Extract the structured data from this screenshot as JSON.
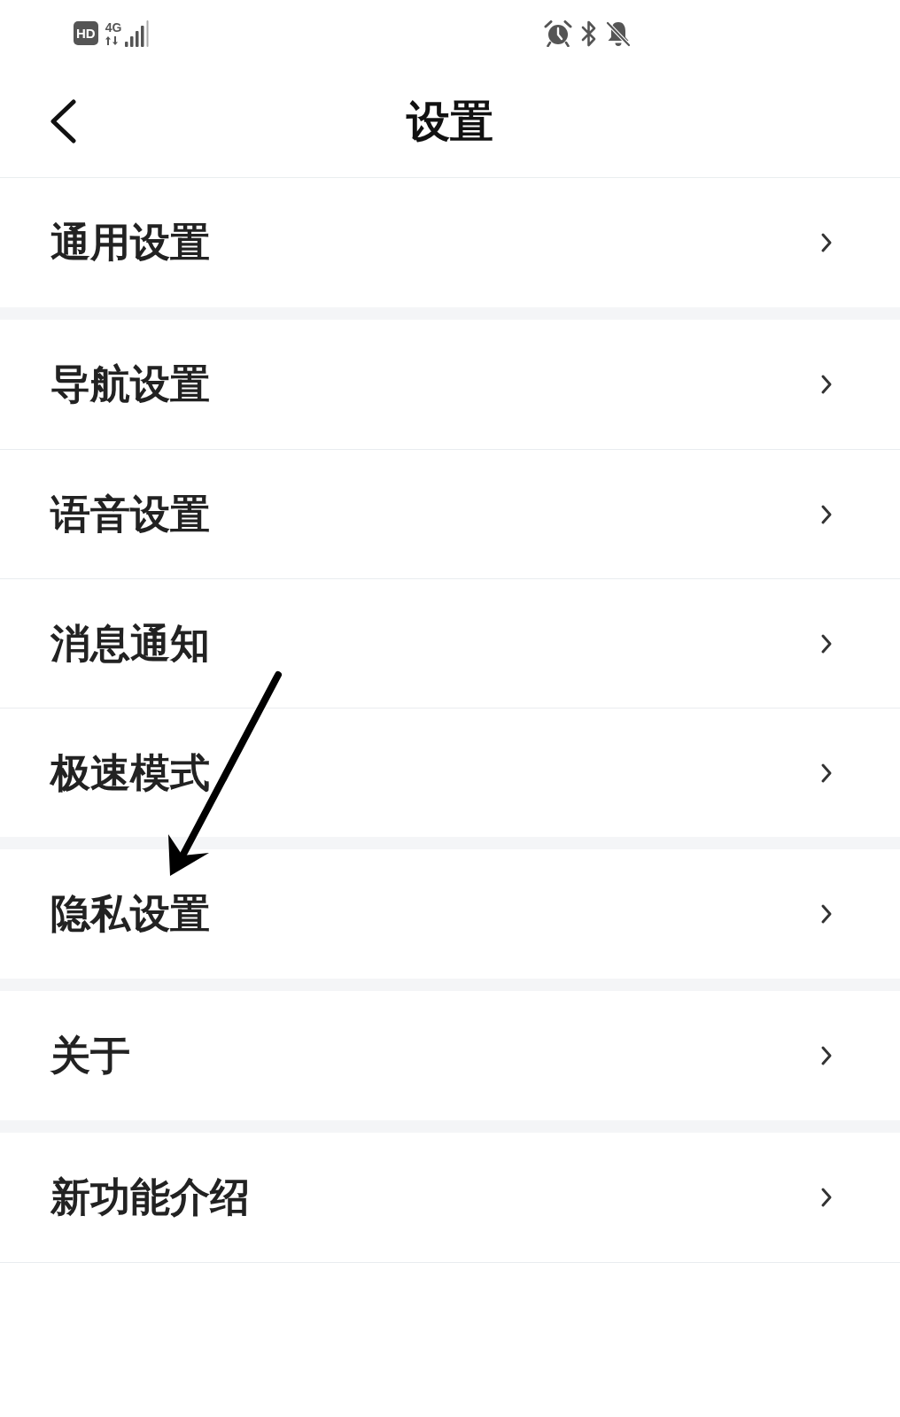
{
  "status_bar": {
    "hd_badge": "HD",
    "network": "4G"
  },
  "header": {
    "title": "设置"
  },
  "groups": [
    {
      "items": [
        {
          "label": "通用设置"
        }
      ]
    },
    {
      "items": [
        {
          "label": "导航设置"
        },
        {
          "label": "语音设置"
        },
        {
          "label": "消息通知"
        },
        {
          "label": "极速模式"
        }
      ]
    },
    {
      "items": [
        {
          "label": "隐私设置"
        }
      ]
    },
    {
      "items": [
        {
          "label": "关于"
        }
      ]
    },
    {
      "items": [
        {
          "label": "新功能介绍"
        }
      ]
    }
  ]
}
